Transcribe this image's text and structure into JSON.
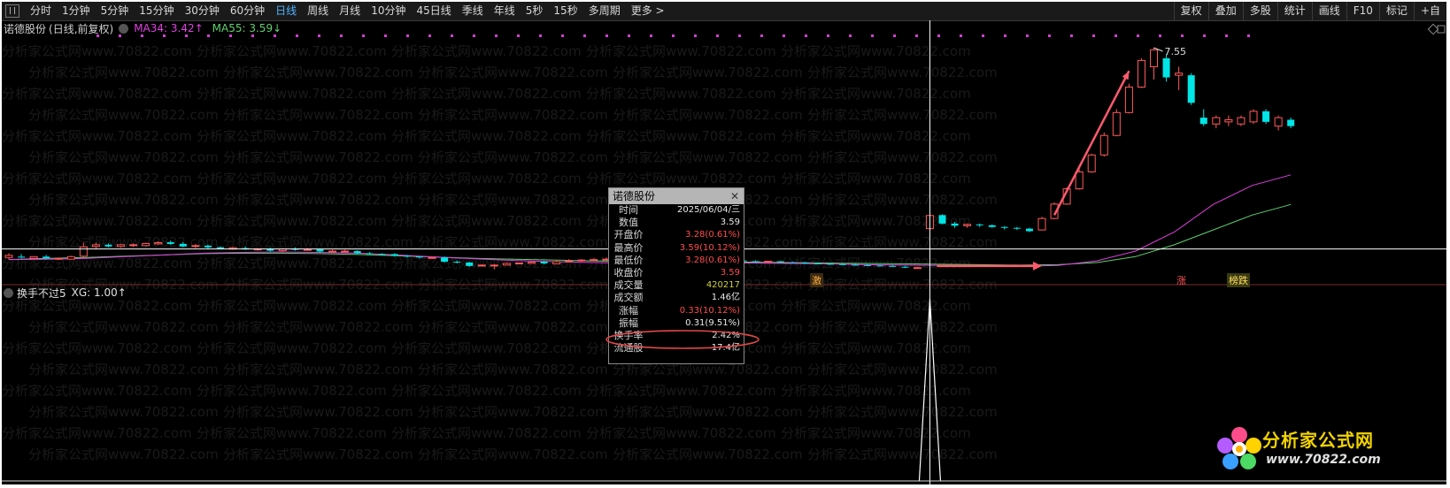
{
  "toolbar": {
    "periods": [
      "分时",
      "1分钟",
      "5分钟",
      "15分钟",
      "30分钟",
      "60分钟",
      "日线",
      "周线",
      "月线",
      "10分钟",
      "45日线",
      "季线",
      "年线",
      "5秒",
      "15秒",
      "多周期",
      "更多 >"
    ],
    "active_period": "日线",
    "right_buttons": [
      "复权",
      "叠加",
      "多股",
      "统计",
      "画线",
      "F10",
      "标记",
      "+自"
    ]
  },
  "main_info": {
    "stock_name": "诺德股份",
    "subtitle": "(日线,前复权)",
    "ma34": "MA34: 3.42↑",
    "ma55": "MA55: 3.59↓"
  },
  "indicator_info": {
    "name": "换手不过5",
    "value": "XG: 1.00↑"
  },
  "high_label": "7.55",
  "popup": {
    "title": "诺德股份",
    "rows": [
      {
        "label": "时间",
        "value": "2025/06/04/三",
        "color": "normal"
      },
      {
        "label": "数值",
        "value": "3.59",
        "color": "normal"
      },
      {
        "label": "开盘价",
        "value": "3.28(0.61%)",
        "color": "red"
      },
      {
        "label": "最高价",
        "value": "3.59(10.12%)",
        "color": "red"
      },
      {
        "label": "最低价",
        "value": "3.28(0.61%)",
        "color": "red"
      },
      {
        "label": "收盘价",
        "value": "3.59",
        "color": "red"
      },
      {
        "label": "成交量",
        "value": "420217",
        "color": "green"
      },
      {
        "label": "成交额",
        "value": "1.46亿",
        "color": "normal"
      },
      {
        "label": "涨幅",
        "value": "0.33(10.12%)",
        "color": "red"
      },
      {
        "label": "振幅",
        "value": "0.31(9.51%)",
        "color": "normal"
      },
      {
        "label": "换手率",
        "value": "2.42%",
        "color": "normal"
      },
      {
        "label": "流通股",
        "value": "17.4亿",
        "color": "normal"
      }
    ]
  },
  "badges": [
    "激",
    "涨",
    "榜跌"
  ],
  "watermark": "分析家公式网www.70822.com",
  "logo": {
    "brand": "分析家公式网",
    "url": "www.70822.com"
  },
  "colors": {
    "up": "#ff5a5a",
    "down": "#00e5e5",
    "ma34": "#e040e0",
    "ma55": "#5fd06f",
    "crosshair": "#ffffff",
    "signal_dot": "#d040d0"
  },
  "chart_data": {
    "type": "candlestick",
    "title": "诺德股份 (日线,前复权)",
    "candles": [
      {
        "o": 2.6,
        "h": 2.7,
        "l": 2.55,
        "c": 2.65
      },
      {
        "o": 2.62,
        "h": 2.68,
        "l": 2.58,
        "c": 2.6
      },
      {
        "o": 2.58,
        "h": 2.63,
        "l": 2.55,
        "c": 2.62
      },
      {
        "o": 2.62,
        "h": 2.66,
        "l": 2.56,
        "c": 2.58
      },
      {
        "o": 2.57,
        "h": 2.6,
        "l": 2.54,
        "c": 2.58
      },
      {
        "o": 2.56,
        "h": 2.64,
        "l": 2.55,
        "c": 2.62
      },
      {
        "o": 2.63,
        "h": 2.95,
        "l": 2.6,
        "c": 2.85
      },
      {
        "o": 2.86,
        "h": 2.95,
        "l": 2.8,
        "c": 2.9
      },
      {
        "o": 2.9,
        "h": 2.93,
        "l": 2.84,
        "c": 2.86
      },
      {
        "o": 2.86,
        "h": 2.92,
        "l": 2.83,
        "c": 2.9
      },
      {
        "o": 2.88,
        "h": 2.93,
        "l": 2.85,
        "c": 2.9
      },
      {
        "o": 2.88,
        "h": 2.95,
        "l": 2.86,
        "c": 2.93
      },
      {
        "o": 2.92,
        "h": 2.98,
        "l": 2.9,
        "c": 2.95
      },
      {
        "o": 2.96,
        "h": 3.0,
        "l": 2.9,
        "c": 2.92
      },
      {
        "o": 2.92,
        "h": 2.96,
        "l": 2.84,
        "c": 2.86
      },
      {
        "o": 2.86,
        "h": 2.92,
        "l": 2.82,
        "c": 2.88
      },
      {
        "o": 2.88,
        "h": 2.9,
        "l": 2.8,
        "c": 2.84
      },
      {
        "o": 2.84,
        "h": 2.86,
        "l": 2.79,
        "c": 2.81
      },
      {
        "o": 2.8,
        "h": 2.85,
        "l": 2.78,
        "c": 2.83
      },
      {
        "o": 2.82,
        "h": 2.86,
        "l": 2.78,
        "c": 2.79
      },
      {
        "o": 2.79,
        "h": 2.82,
        "l": 2.76,
        "c": 2.8
      },
      {
        "o": 2.8,
        "h": 2.83,
        "l": 2.74,
        "c": 2.76
      },
      {
        "o": 2.76,
        "h": 2.82,
        "l": 2.74,
        "c": 2.8
      },
      {
        "o": 2.81,
        "h": 2.84,
        "l": 2.76,
        "c": 2.78
      },
      {
        "o": 2.78,
        "h": 2.82,
        "l": 2.76,
        "c": 2.79
      },
      {
        "o": 2.79,
        "h": 2.8,
        "l": 2.72,
        "c": 2.74
      },
      {
        "o": 2.74,
        "h": 2.78,
        "l": 2.72,
        "c": 2.75
      },
      {
        "o": 2.75,
        "h": 2.78,
        "l": 2.73,
        "c": 2.75
      },
      {
        "o": 2.75,
        "h": 2.77,
        "l": 2.68,
        "c": 2.7
      },
      {
        "o": 2.7,
        "h": 2.73,
        "l": 2.66,
        "c": 2.68
      },
      {
        "o": 2.68,
        "h": 2.7,
        "l": 2.66,
        "c": 2.67
      },
      {
        "o": 2.68,
        "h": 2.7,
        "l": 2.62,
        "c": 2.64
      },
      {
        "o": 2.64,
        "h": 2.66,
        "l": 2.6,
        "c": 2.62
      },
      {
        "o": 2.62,
        "h": 2.63,
        "l": 2.58,
        "c": 2.6
      },
      {
        "o": 2.6,
        "h": 2.61,
        "l": 2.57,
        "c": 2.6
      },
      {
        "o": 2.6,
        "h": 2.62,
        "l": 2.48,
        "c": 2.5
      },
      {
        "o": 2.5,
        "h": 2.53,
        "l": 2.46,
        "c": 2.49
      },
      {
        "o": 2.48,
        "h": 2.5,
        "l": 2.38,
        "c": 2.4
      },
      {
        "o": 2.4,
        "h": 2.44,
        "l": 2.38,
        "c": 2.42
      },
      {
        "o": 2.4,
        "h": 2.44,
        "l": 2.32,
        "c": 2.42
      },
      {
        "o": 2.42,
        "h": 2.48,
        "l": 2.41,
        "c": 2.46
      },
      {
        "o": 2.46,
        "h": 2.48,
        "l": 2.44,
        "c": 2.47
      },
      {
        "o": 2.46,
        "h": 2.5,
        "l": 2.45,
        "c": 2.49
      },
      {
        "o": 2.5,
        "h": 2.52,
        "l": 2.44,
        "c": 2.46
      },
      {
        "o": 2.45,
        "h": 2.52,
        "l": 2.44,
        "c": 2.5
      },
      {
        "o": 2.5,
        "h": 2.56,
        "l": 2.48,
        "c": 2.52
      },
      {
        "o": 2.52,
        "h": 2.56,
        "l": 2.5,
        "c": 2.54
      },
      {
        "o": 2.54,
        "h": 2.58,
        "l": 2.52,
        "c": 2.55
      },
      {
        "o": 2.55,
        "h": 2.6,
        "l": 2.54,
        "c": 2.56
      },
      {
        "o": 2.56,
        "h": 2.58,
        "l": 2.53,
        "c": 2.54
      },
      {
        "o": 2.54,
        "h": 2.56,
        "l": 2.52,
        "c": 2.53
      },
      {
        "o": 2.53,
        "h": 2.55,
        "l": 2.52,
        "c": 2.53
      },
      {
        "o": 2.53,
        "h": 2.55,
        "l": 2.5,
        "c": 2.51
      },
      {
        "o": 2.51,
        "h": 2.52,
        "l": 2.5,
        "c": 2.51
      },
      {
        "o": 2.51,
        "h": 2.52,
        "l": 2.49,
        "c": 2.5
      },
      {
        "o": 2.5,
        "h": 2.51,
        "l": 2.48,
        "c": 2.49
      },
      {
        "o": 2.45,
        "h": 2.52,
        "l": 2.44,
        "c": 2.51
      },
      {
        "o": 2.51,
        "h": 2.54,
        "l": 2.49,
        "c": 2.52
      },
      {
        "o": 2.52,
        "h": 2.54,
        "l": 2.5,
        "c": 2.53
      },
      {
        "o": 2.53,
        "h": 2.54,
        "l": 2.5,
        "c": 2.51
      },
      {
        "o": 2.51,
        "h": 2.53,
        "l": 2.48,
        "c": 2.49
      },
      {
        "o": 2.49,
        "h": 2.52,
        "l": 2.48,
        "c": 2.51
      },
      {
        "o": 2.51,
        "h": 2.52,
        "l": 2.48,
        "c": 2.49
      },
      {
        "o": 2.49,
        "h": 2.5,
        "l": 2.47,
        "c": 2.48
      },
      {
        "o": 2.48,
        "h": 2.49,
        "l": 2.45,
        "c": 2.46
      },
      {
        "o": 2.46,
        "h": 2.48,
        "l": 2.44,
        "c": 2.45
      },
      {
        "o": 2.45,
        "h": 2.47,
        "l": 2.43,
        "c": 2.44
      },
      {
        "o": 2.44,
        "h": 2.46,
        "l": 2.42,
        "c": 2.43
      },
      {
        "o": 2.43,
        "h": 2.45,
        "l": 2.41,
        "c": 2.42
      },
      {
        "o": 2.42,
        "h": 2.44,
        "l": 2.4,
        "c": 2.41
      },
      {
        "o": 2.41,
        "h": 2.43,
        "l": 2.39,
        "c": 2.4
      },
      {
        "o": 2.4,
        "h": 2.43,
        "l": 2.38,
        "c": 2.39
      },
      {
        "o": 2.38,
        "h": 2.4,
        "l": 2.35,
        "c": 2.37
      },
      {
        "o": 2.36,
        "h": 2.38,
        "l": 2.34,
        "c": 2.36
      },
      {
        "o": 3.28,
        "h": 3.59,
        "l": 3.28,
        "c": 3.59
      },
      {
        "o": 3.6,
        "h": 3.62,
        "l": 3.38,
        "c": 3.4
      },
      {
        "o": 3.4,
        "h": 3.44,
        "l": 3.3,
        "c": 3.35
      },
      {
        "o": 3.35,
        "h": 3.4,
        "l": 3.3,
        "c": 3.38
      },
      {
        "o": 3.38,
        "h": 3.4,
        "l": 3.32,
        "c": 3.36
      },
      {
        "o": 3.36,
        "h": 3.38,
        "l": 3.3,
        "c": 3.32
      },
      {
        "o": 3.32,
        "h": 3.34,
        "l": 3.26,
        "c": 3.3
      },
      {
        "o": 3.3,
        "h": 3.32,
        "l": 3.25,
        "c": 3.28
      },
      {
        "o": 3.28,
        "h": 3.3,
        "l": 3.2,
        "c": 3.22
      },
      {
        "o": 3.25,
        "h": 3.56,
        "l": 3.24,
        "c": 3.52
      },
      {
        "o": 3.52,
        "h": 3.9,
        "l": 3.5,
        "c": 3.86
      },
      {
        "o": 3.86,
        "h": 4.25,
        "l": 3.84,
        "c": 4.22
      },
      {
        "o": 4.22,
        "h": 4.68,
        "l": 4.2,
        "c": 4.62
      },
      {
        "o": 4.62,
        "h": 5.05,
        "l": 4.6,
        "c": 5.02
      },
      {
        "o": 5.02,
        "h": 5.55,
        "l": 4.98,
        "c": 5.48
      },
      {
        "o": 5.48,
        "h": 6.1,
        "l": 5.46,
        "c": 6.02
      },
      {
        "o": 6.02,
        "h": 6.7,
        "l": 6.0,
        "c": 6.62
      },
      {
        "o": 6.62,
        "h": 7.3,
        "l": 6.6,
        "c": 7.25
      },
      {
        "o": 7.1,
        "h": 7.55,
        "l": 6.8,
        "c": 7.5
      },
      {
        "o": 7.3,
        "h": 7.4,
        "l": 6.75,
        "c": 6.85
      },
      {
        "o": 6.9,
        "h": 7.1,
        "l": 6.55,
        "c": 6.95
      },
      {
        "o": 6.9,
        "h": 6.95,
        "l": 6.2,
        "c": 6.25
      },
      {
        "o": 5.9,
        "h": 6.1,
        "l": 5.7,
        "c": 5.75
      },
      {
        "o": 5.75,
        "h": 5.95,
        "l": 5.65,
        "c": 5.9
      },
      {
        "o": 5.8,
        "h": 5.95,
        "l": 5.7,
        "c": 5.85
      },
      {
        "o": 5.75,
        "h": 5.95,
        "l": 5.7,
        "c": 5.9
      },
      {
        "o": 5.8,
        "h": 6.1,
        "l": 5.75,
        "c": 6.05
      },
      {
        "o": 6.05,
        "h": 6.1,
        "l": 5.75,
        "c": 5.8
      },
      {
        "o": 5.7,
        "h": 5.95,
        "l": 5.6,
        "c": 5.9
      },
      {
        "o": 5.85,
        "h": 5.9,
        "l": 5.65,
        "c": 5.7
      }
    ],
    "ma34": [
      2.55,
      2.56,
      2.58,
      2.62,
      2.66,
      2.7,
      2.72,
      2.73,
      2.72,
      2.7,
      2.66,
      2.61,
      2.57,
      2.53,
      2.5,
      2.48,
      2.47,
      2.47,
      2.47,
      2.47,
      2.46,
      2.45,
      2.43,
      2.42,
      2.41,
      2.4,
      2.39,
      2.41,
      2.52,
      2.75,
      3.2,
      3.85,
      4.3,
      4.55
    ],
    "ma55": [
      2.55,
      2.58,
      2.6,
      2.63,
      2.66,
      2.69,
      2.7,
      2.7,
      2.69,
      2.67,
      2.64,
      2.61,
      2.58,
      2.56,
      2.54,
      2.52,
      2.51,
      2.51,
      2.5,
      2.49,
      2.48,
      2.47,
      2.46,
      2.45,
      2.44,
      2.43,
      2.42,
      2.43,
      2.48,
      2.62,
      2.9,
      3.25,
      3.6,
      3.85
    ],
    "crosshair_value": 2.8,
    "indicator": {
      "name": "换手不过5",
      "signal": "XG",
      "value": 1.0,
      "signal_candle_index": 74
    }
  }
}
